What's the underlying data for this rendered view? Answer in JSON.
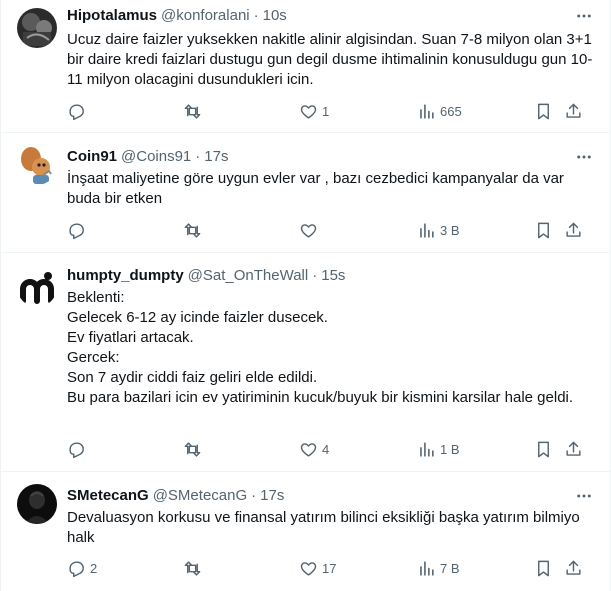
{
  "tweets": [
    {
      "name": "Hipotalamus",
      "handle": "@konforalani",
      "separator": "·",
      "time": "10s",
      "text": "Ucuz daire faizler yuksekken nakitle alinir algisindan. Suan 7-8 milyon olan 3+1 bir daire kredi faizlari dustugu gun degil dusme ihtimalinin konusuldugu gun 10-11 milyon olacagini dusundukleri icin.",
      "replies": "",
      "retweets": "",
      "likes": "1",
      "views": "665",
      "avatar_icon": "dark-photo-avatar"
    },
    {
      "name": "Coin91",
      "handle": "@Coins91",
      "separator": "·",
      "time": "17s",
      "text": "İnşaat maliyetine göre uygun evler var , bazı cezbedici kampanyalar da var buda bir etken",
      "replies": "",
      "retweets": "",
      "likes": "",
      "views": "3 B",
      "avatar_icon": "cartoon-squirrel-avatar"
    },
    {
      "name": "humpty_dumpty",
      "handle": "@Sat_OnTheWall",
      "separator": "·",
      "time": "15s",
      "text": "Beklenti:\nGelecek 6-12 ay icinde faizler dusecek.\nEv fiyatlari artacak.\nGercek:\nSon 7 aydir ciddi faiz geliri elde edildi.\nBu para bazilari icin ev yatiriminin kucuk/buyuk bir kismini karsilar hale geldi.",
      "replies": "",
      "retweets": "",
      "likes": "4",
      "views": "1 B",
      "avatar_icon": "m-logo-avatar"
    },
    {
      "name": "SMetecanG",
      "handle": "@SMetecanG",
      "separator": "·",
      "time": "17s",
      "text": "Devaluasyon korkusu ve finansal yatırım bilinci eksikliği başka yatırım bilmiyo halk",
      "replies": "2",
      "retweets": "",
      "likes": "17",
      "views": "7 B",
      "avatar_icon": "dark-portrait-avatar"
    }
  ],
  "colors": {
    "text": "#0f1419",
    "secondary": "#536471",
    "border": "#eff3f4"
  }
}
